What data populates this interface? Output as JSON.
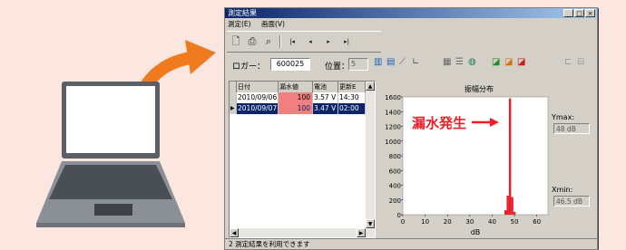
{
  "window": {
    "title": "測定結果",
    "menu": [
      "測定(E)",
      "画面(V)"
    ],
    "status": "2 測定結果を利用できます"
  },
  "toolbar": {
    "icons": [
      "print-preview-icon",
      "print-icon",
      "search-icon",
      "first-icon",
      "prev-icon",
      "next-icon",
      "last-icon"
    ]
  },
  "logger": {
    "label": "ロガー：",
    "value": "600025",
    "position_label": "位置：",
    "position_value": "5"
  },
  "table": {
    "columns": [
      "日付",
      "漏水値",
      "電池",
      "更新E"
    ],
    "rows": [
      {
        "date": "2010/09/06",
        "leak": "100",
        "battery": "3.57 V",
        "update": "14:30",
        "selected": false
      },
      {
        "date": "2010/09/07",
        "leak": "100",
        "battery": "3.47 V",
        "update": "02:00",
        "selected": true
      }
    ]
  },
  "chart_data": {
    "type": "bar",
    "title": "振幅分布",
    "xlabel": "dB",
    "ylabel": "",
    "xlim": [
      0,
      65
    ],
    "ylim": [
      0,
      1600
    ],
    "xticks": [
      0,
      10,
      20,
      30,
      40,
      50,
      60
    ],
    "yticks": [
      0,
      200,
      400,
      600,
      800,
      1000,
      1200,
      1400,
      1600
    ],
    "x": [
      46,
      47,
      48,
      49,
      50
    ],
    "values": [
      60,
      260,
      1580,
      240,
      40
    ],
    "annotation": "漏水発生",
    "bar_color": "#e8202a",
    "ymax_label": "Ymax:",
    "ymax_value": "48 dB",
    "xmin_label": "Xmin:",
    "xmin_value": "46.5 dB"
  },
  "colors": {
    "background": "#fbe6e0",
    "arrow": "#f07b1e",
    "leak_cell": "#f08080",
    "selected_row": "#0a246a"
  }
}
